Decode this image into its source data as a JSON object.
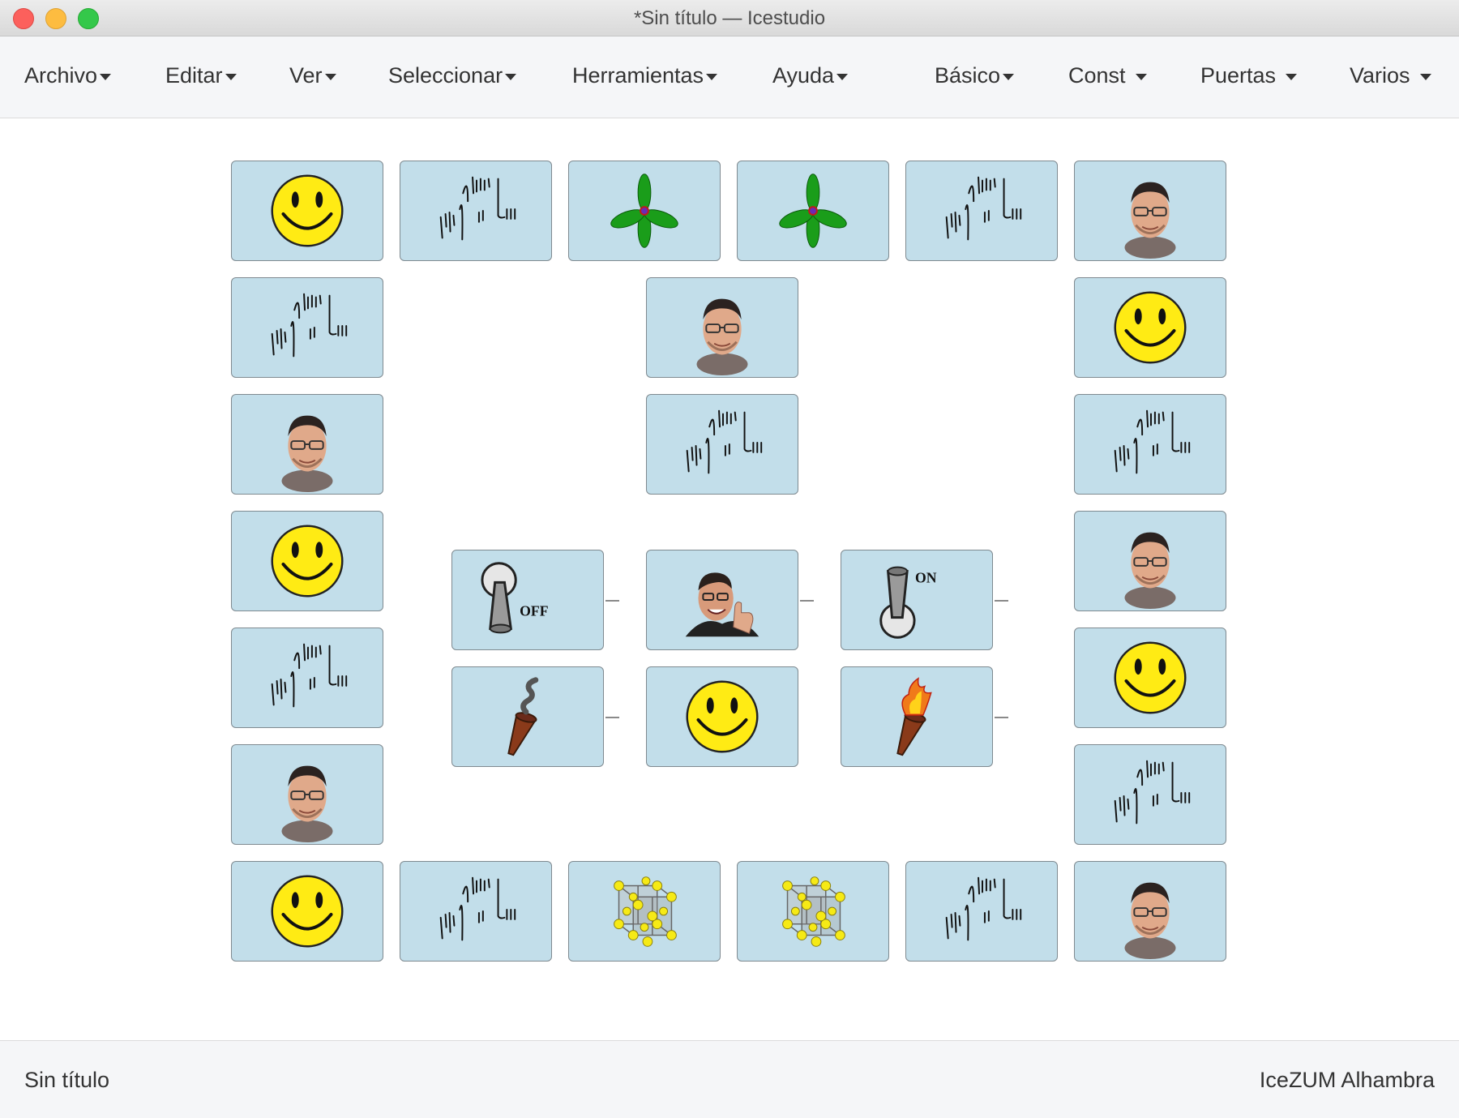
{
  "window": {
    "title": "*Sin título — Icestudio"
  },
  "menu": {
    "left": [
      "Archivo",
      "Editar",
      "Ver",
      "Seleccionar",
      "Herramientas",
      "Ayuda"
    ],
    "right": [
      "Básico",
      "Const",
      "Puertas",
      "Varios"
    ]
  },
  "board": {
    "tiles": [
      {
        "icon": "smiley-icon"
      },
      {
        "icon": "signature-icon"
      },
      {
        "icon": "propeller-icon"
      },
      {
        "icon": "propeller-icon"
      },
      {
        "icon": "signature-icon"
      },
      {
        "icon": "face-photo-icon"
      },
      {
        "icon": "signature-icon"
      },
      {
        "icon": "face-photo-icon"
      },
      {
        "icon": "smiley-icon"
      },
      {
        "icon": "face-photo-icon"
      },
      {
        "icon": "signature-icon"
      },
      {
        "icon": "signature-icon"
      },
      {
        "icon": "smiley-icon"
      },
      {
        "icon": "switch-off-icon"
      },
      {
        "icon": "thumbs-up-photo-icon"
      },
      {
        "icon": "switch-on-icon"
      },
      {
        "icon": "face-photo-icon"
      },
      {
        "icon": "signature-icon"
      },
      {
        "icon": "torch-off-icon"
      },
      {
        "icon": "smiley-icon"
      },
      {
        "icon": "torch-on-icon"
      },
      {
        "icon": "smiley-icon"
      },
      {
        "icon": "face-photo-icon"
      },
      {
        "icon": "signature-icon"
      },
      {
        "icon": "smiley-icon"
      },
      {
        "icon": "signature-icon"
      },
      {
        "icon": "crystal-icon"
      },
      {
        "icon": "crystal-icon"
      },
      {
        "icon": "signature-icon"
      },
      {
        "icon": "face-photo-icon"
      }
    ],
    "switch_off_label": "OFF",
    "switch_on_label": "ON"
  },
  "status": {
    "file": "Sin título",
    "board": "IceZUM Alhambra"
  },
  "colors": {
    "tile_bg": "#c2deea",
    "tile_border": "#7f8a90",
    "bar_bg": "#f5f6f8"
  }
}
